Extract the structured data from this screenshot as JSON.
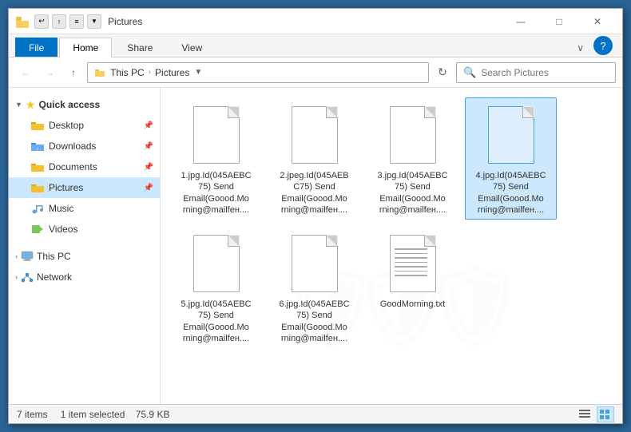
{
  "window": {
    "title": "Pictures",
    "icon": "📁"
  },
  "titlebar": {
    "qat": [
      "undo",
      "redo",
      "properties"
    ],
    "controls": {
      "minimize": "—",
      "maximize": "□",
      "close": "✕"
    }
  },
  "ribbon": {
    "tabs": [
      "File",
      "Home",
      "Share",
      "View"
    ],
    "active_tab": "Home",
    "chevron": "∨",
    "help": "?"
  },
  "addressbar": {
    "back_title": "Back",
    "forward_title": "Forward",
    "up_title": "Up",
    "path": [
      "This PC",
      "Pictures"
    ],
    "refresh_title": "Refresh",
    "search_placeholder": "Search Pictures"
  },
  "sidebar": {
    "sections": [
      {
        "id": "quick-access",
        "label": "Quick access",
        "icon": "star",
        "items": [
          {
            "id": "desktop",
            "label": "Desktop",
            "icon": "folder",
            "pinned": true
          },
          {
            "id": "downloads",
            "label": "Downloads",
            "icon": "folder-download",
            "pinned": true
          },
          {
            "id": "documents",
            "label": "Documents",
            "icon": "folder-doc",
            "pinned": true
          },
          {
            "id": "pictures",
            "label": "Pictures",
            "icon": "folder-pic",
            "pinned": true,
            "active": true
          }
        ]
      },
      {
        "id": "music",
        "label": "Music",
        "icon": "music"
      },
      {
        "id": "videos",
        "label": "Videos",
        "icon": "videos"
      },
      {
        "id": "this-pc",
        "label": "This PC",
        "icon": "computer"
      },
      {
        "id": "network",
        "label": "Network",
        "icon": "network"
      }
    ]
  },
  "files": [
    {
      "id": "file1",
      "name": "1.jpg.Id(045AEBC75) Send Email(Goood.Morning@mailfен....",
      "type": "doc",
      "selected": false
    },
    {
      "id": "file2",
      "name": "2.jpeg.Id(045AEBC75) Send Email(Goood.Morning@mailfен....",
      "type": "doc",
      "selected": false
    },
    {
      "id": "file3",
      "name": "3.jpg.Id(045AEBC75) Send Email(Goood.Morning@mailfен....",
      "type": "doc",
      "selected": false
    },
    {
      "id": "file4",
      "name": "4.jpg.Id(045AEBC75) Send Email(Goood.Morning@mailfен....",
      "type": "doc",
      "selected": true
    },
    {
      "id": "file5",
      "name": "5.jpg.Id(045AEBC75) Send Email(Goood.Morning@mailfен....",
      "type": "doc",
      "selected": false
    },
    {
      "id": "file6",
      "name": "6.jpg.Id(045AEBC75) Send Email(Goood.Morning@mailfен....",
      "type": "doc",
      "selected": false
    },
    {
      "id": "file7",
      "name": "GoodMorning.txt",
      "type": "txt",
      "selected": false
    }
  ],
  "statusbar": {
    "item_count": "7 items",
    "selection": "1 item selected",
    "size": "75.9 KB"
  },
  "colors": {
    "accent": "#0072c6",
    "selected_bg": "#cce8ff",
    "selected_border": "#4a9fd4",
    "hover_bg": "#e8f4fd"
  }
}
